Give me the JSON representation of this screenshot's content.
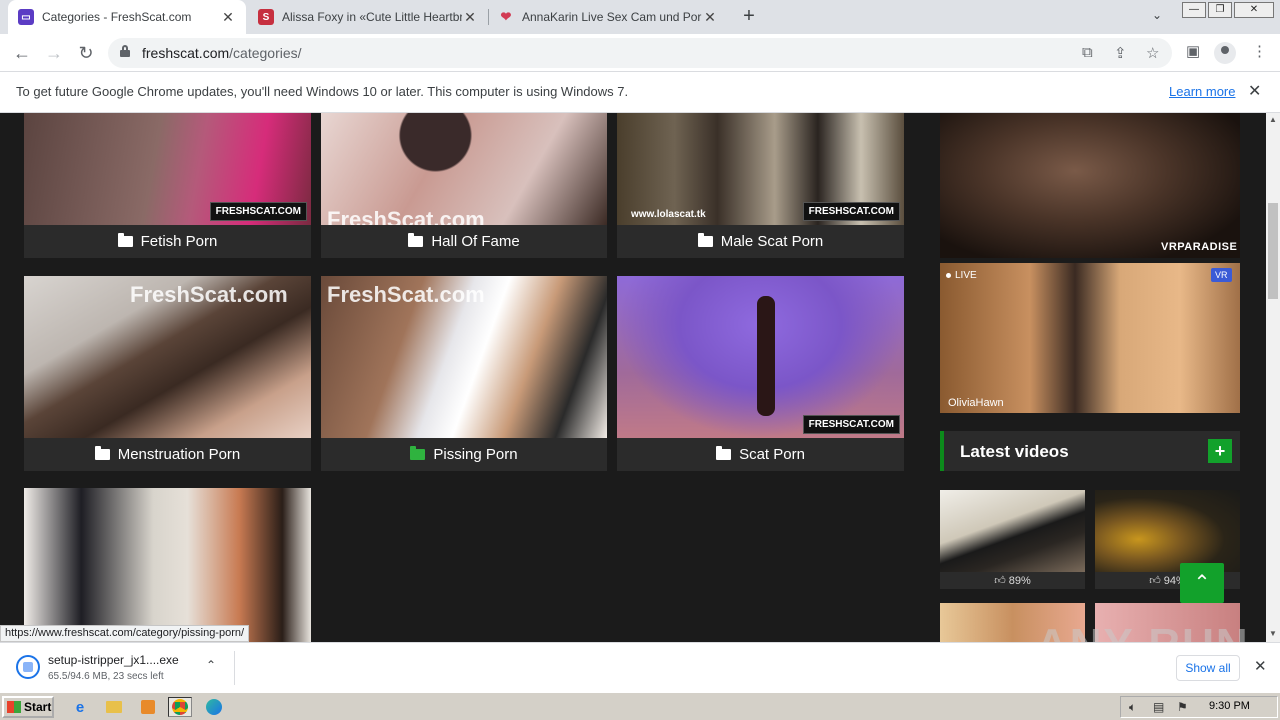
{
  "browser": {
    "tabs": [
      {
        "title": "Categories - FreshScat.com",
        "active": true,
        "favicon_color": "#5b3cc4"
      },
      {
        "title": "Alissa Foxy in «Cute Little Heartbrea",
        "active": false,
        "favicon_color": "#c62f3f"
      },
      {
        "title": "AnnaKarin Live Sex Cam und Porno C",
        "active": false,
        "favicon_color": "#d23a53"
      }
    ],
    "address": {
      "host": "freshscat.com",
      "path": "/categories/"
    },
    "infobar": {
      "message": "To get future Google Chrome updates, you'll need Windows 10 or later. This computer is using Windows 7.",
      "link": "Learn more"
    }
  },
  "categories": [
    {
      "label": "Fetish Porn",
      "watermark": "FRESHSCAT.COM",
      "highlight": false
    },
    {
      "label": "Hall Of Fame",
      "watermark": "FreshScat.com",
      "highlight": false
    },
    {
      "label": "Male Scat Porn",
      "watermark": "FRESHSCAT.COM",
      "site_text": "www.lolascat.tk",
      "highlight": false
    },
    {
      "label": "Menstruation Porn",
      "watermark": "FreshScat.com",
      "highlight": false
    },
    {
      "label": "Pissing Porn",
      "watermark": "FreshScat.com",
      "highlight": true
    },
    {
      "label": "Scat Porn",
      "watermark": "FRESHSCAT.COM",
      "highlight": false
    }
  ],
  "sidebar": {
    "ad_brand": "VRPARADISE",
    "live_label": "LIVE",
    "vr_label": "VR",
    "cam_name": "OliviaHawn",
    "latest_title": "Latest videos",
    "plus_label": "+",
    "videos": [
      {
        "rating": "89%"
      },
      {
        "rating": "94%"
      }
    ]
  },
  "status_url": "https://www.freshscat.com/category/pissing-porn/",
  "download": {
    "filename": "setup-istripper_jx1....exe",
    "progress": "65.5/94.6 MB, 23 secs left",
    "show_all": "Show all"
  },
  "watermark": "ANY RUN",
  "taskbar": {
    "start": "Start",
    "time": "9:30 PM"
  },
  "colors": {
    "accent_green": "#12a12b",
    "caption_bg": "#2b2b2b",
    "page_bg": "#1b1b1b"
  }
}
